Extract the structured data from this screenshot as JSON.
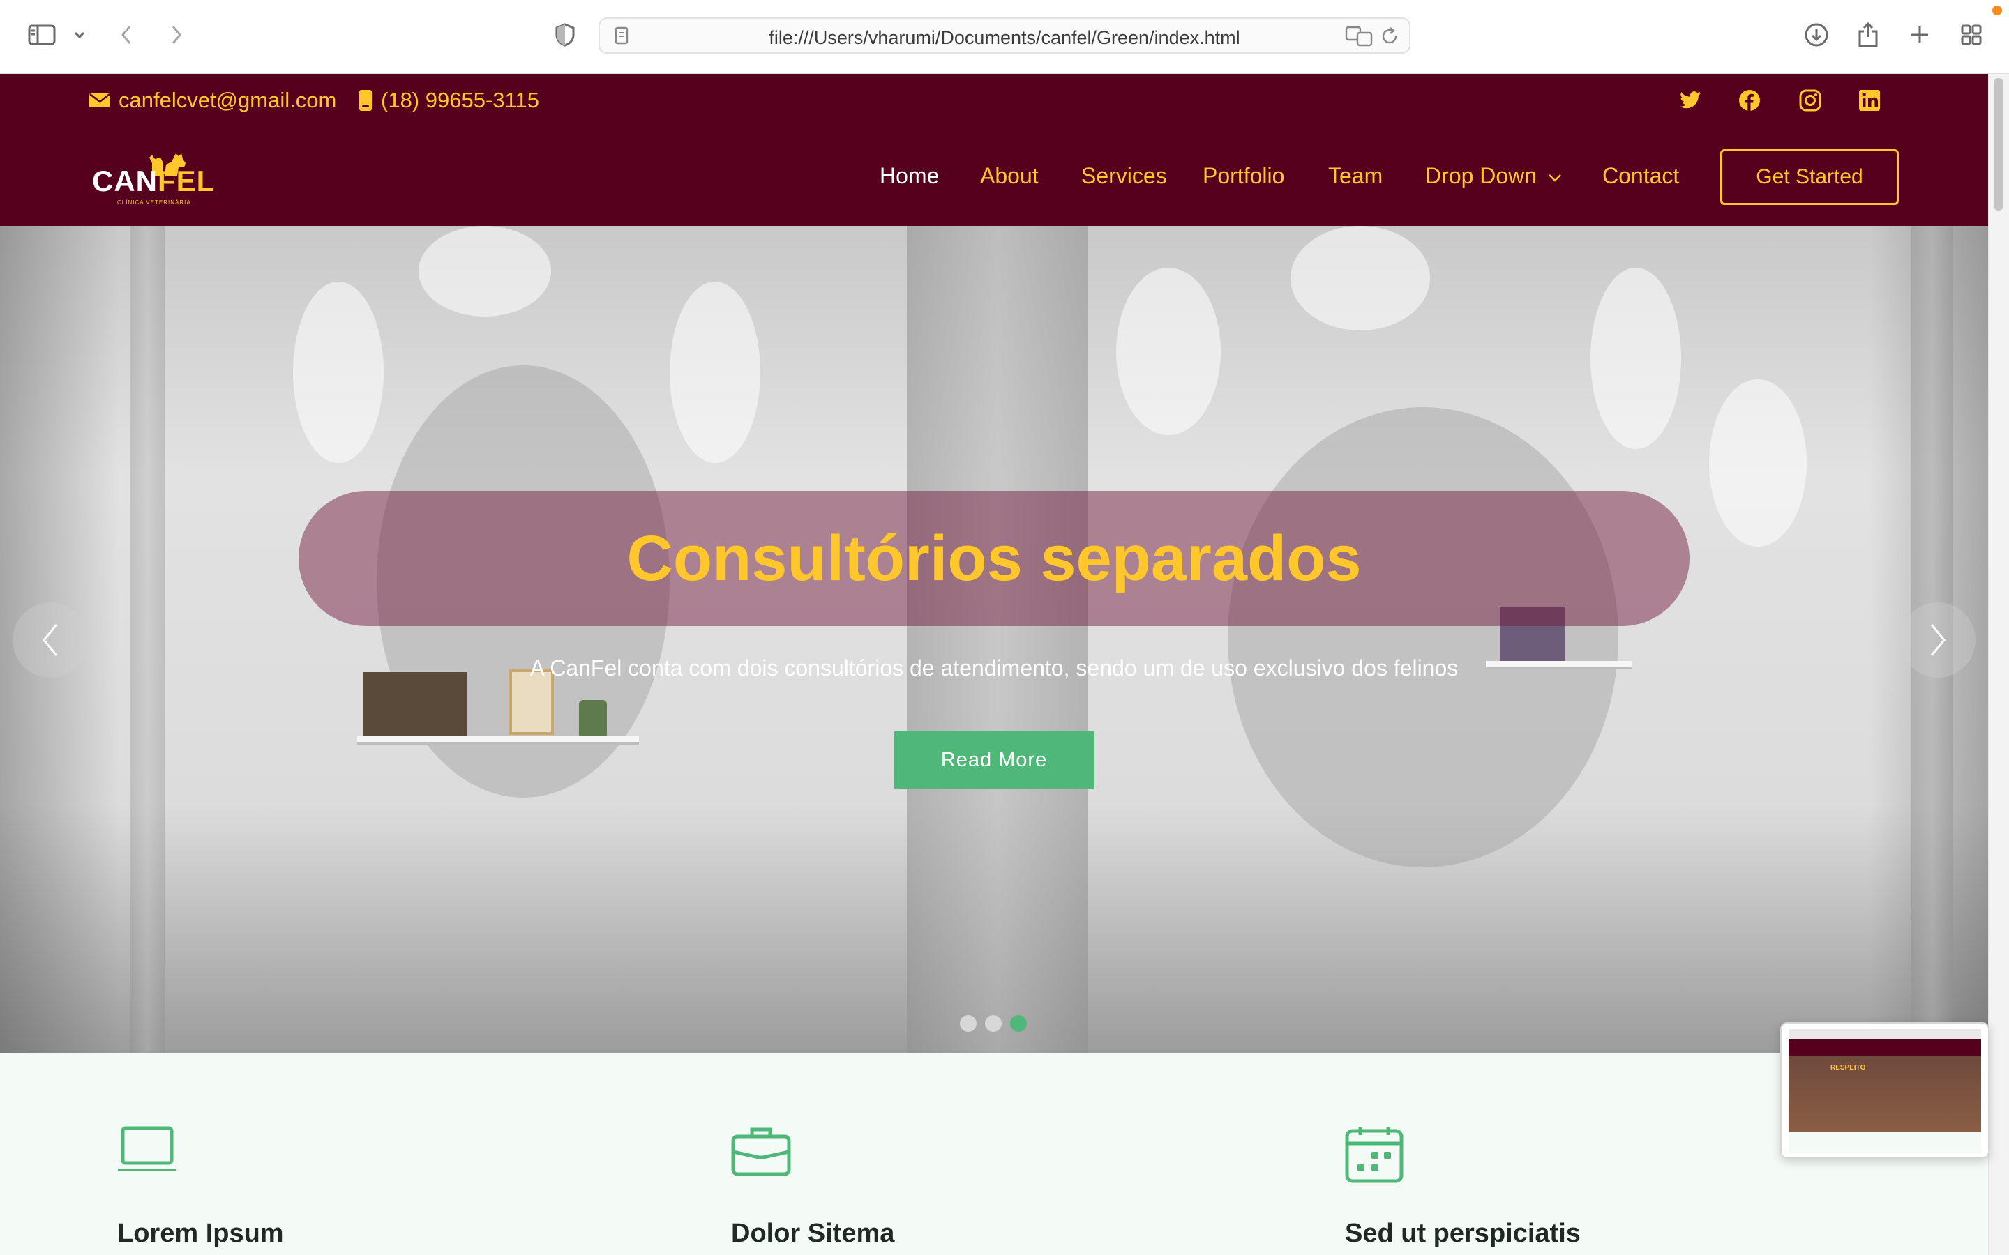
{
  "browser": {
    "url": "file:///Users/vharumi/Documents/canfel/Green/index.html"
  },
  "topbar": {
    "email": "canfelcvet@gmail.com",
    "phone": "(18) 99655-3115",
    "social": [
      "twitter-icon",
      "facebook-icon",
      "instagram-icon",
      "linkedin-icon"
    ]
  },
  "logo": {
    "text_can": "CAN",
    "text_fel": "FEL",
    "subtitle": "CLÍNICA VETERINÁRIA"
  },
  "nav": {
    "items": [
      {
        "label": "Home"
      },
      {
        "label": "About"
      },
      {
        "label": "Services"
      },
      {
        "label": "Portfolio"
      },
      {
        "label": "Team"
      },
      {
        "label": "Drop Down"
      },
      {
        "label": "Contact"
      }
    ],
    "active_index": 0,
    "cta": "Get Started"
  },
  "hero": {
    "title": "Consultórios separados",
    "text": "A CanFel conta com dois consultórios de atendimento, sendo um de uso exclusivo dos felinos",
    "button": "Read More",
    "slide_count": 3,
    "active_slide": 3
  },
  "features": [
    {
      "icon": "laptop-icon",
      "title": "Lorem Ipsum"
    },
    {
      "icon": "briefcase-icon",
      "title": "Dolor Sitema"
    },
    {
      "icon": "calendar-icon",
      "title": "Sed ut perspiciatis"
    }
  ],
  "preview": {
    "caption": "RESPEITO"
  },
  "colors": {
    "header_bg": "#55001c",
    "accent_yellow": "#ffc72c",
    "accent_green": "#4fb878",
    "page_bg": "#f4faf6"
  }
}
